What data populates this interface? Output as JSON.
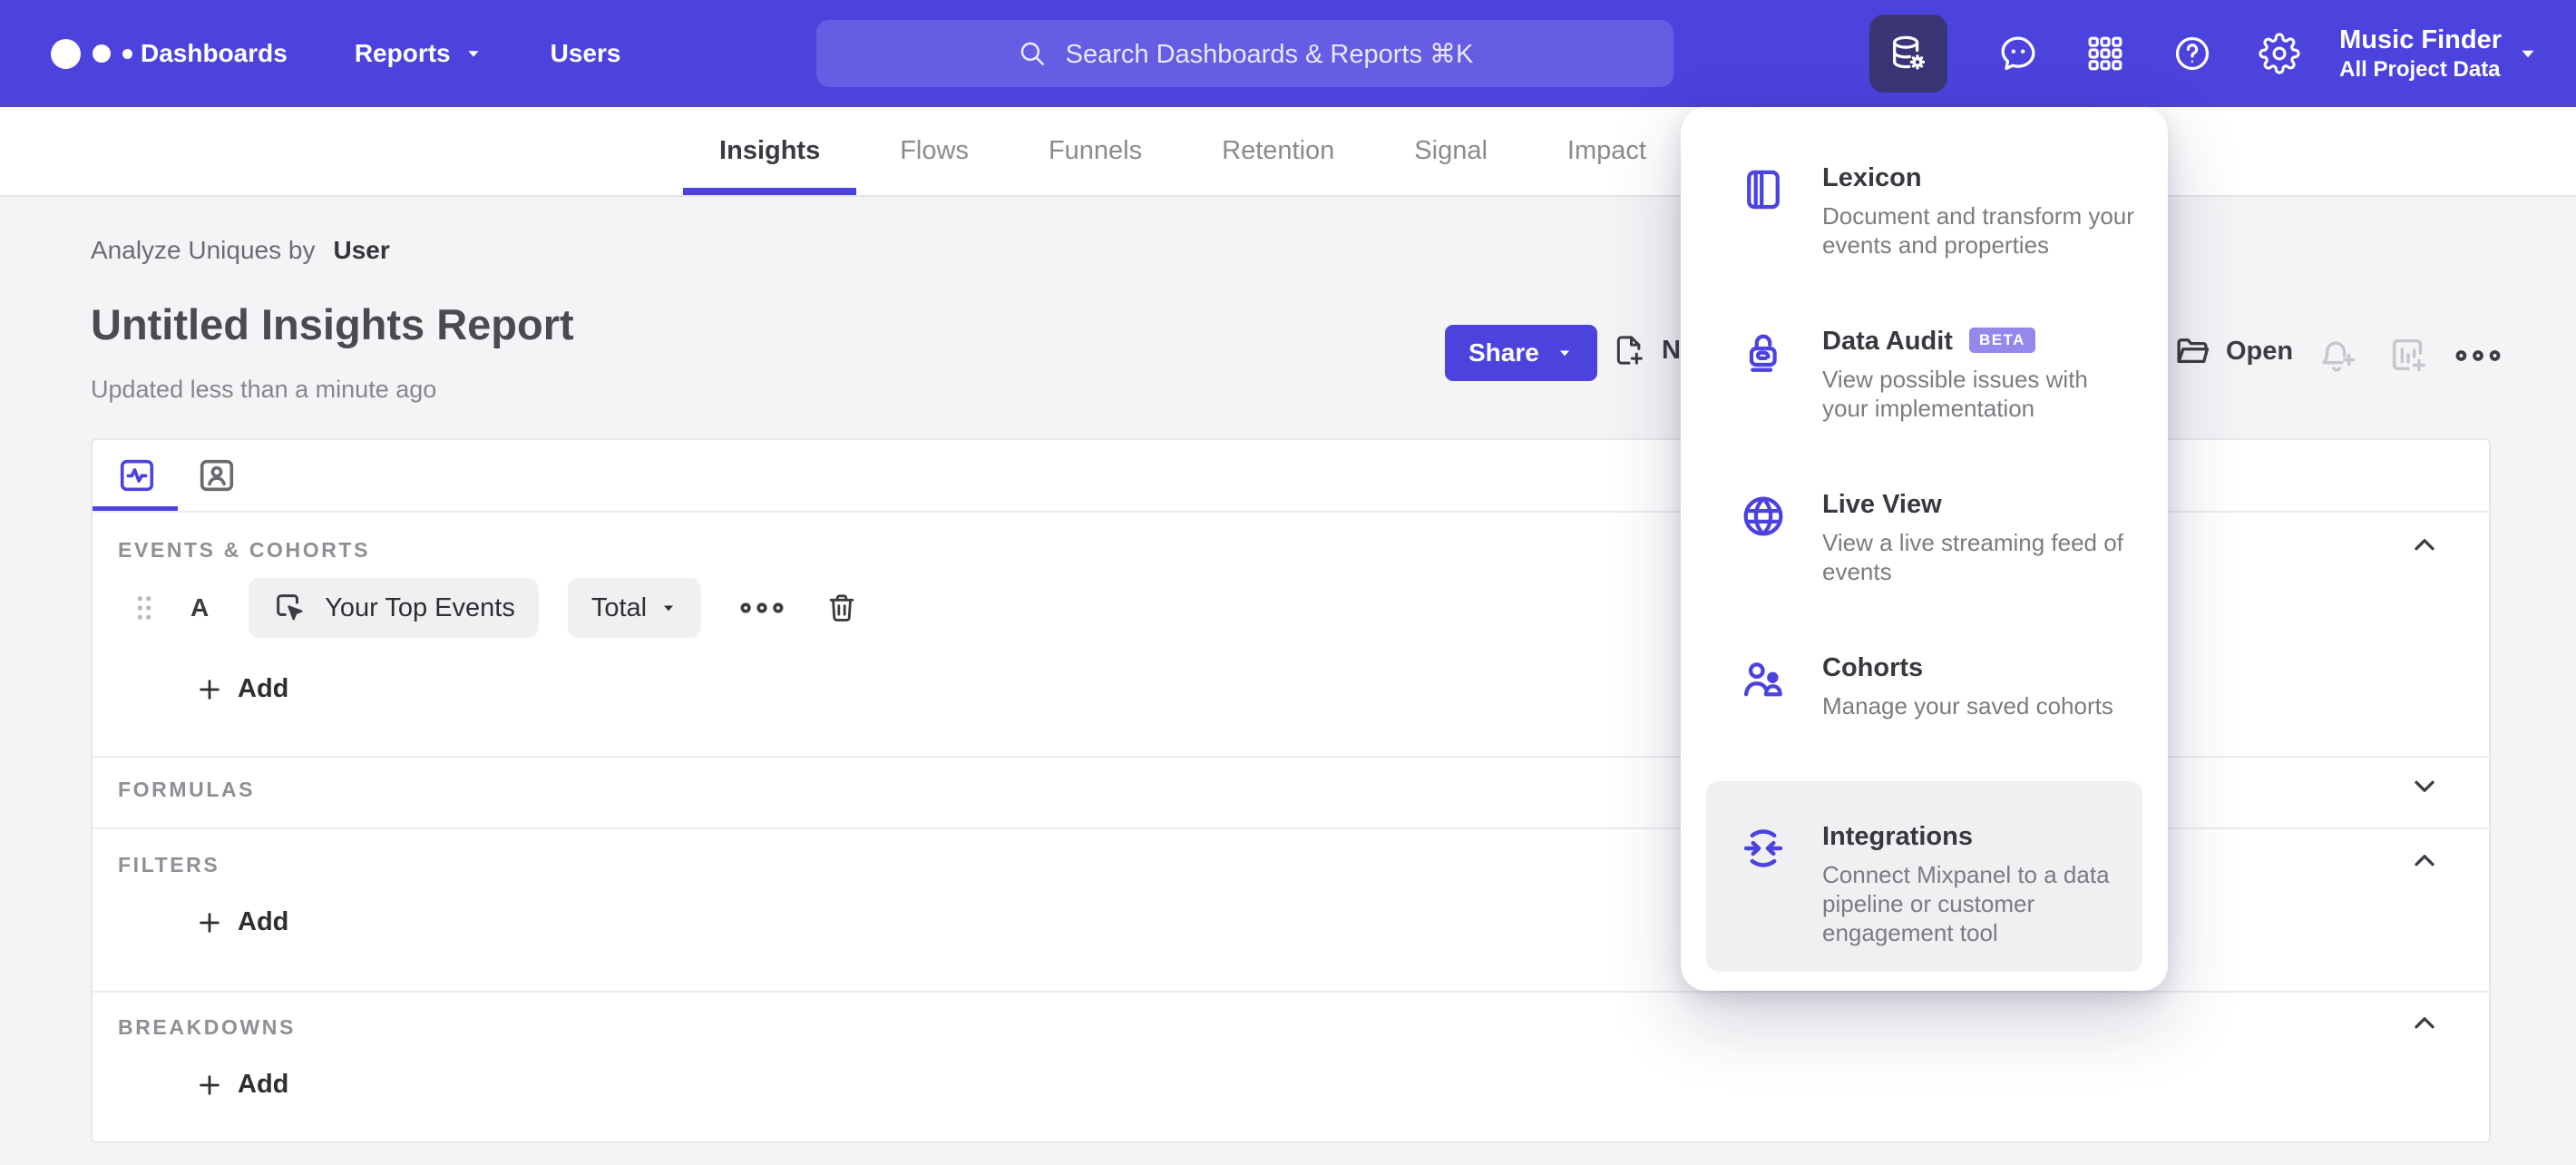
{
  "nav": {
    "menu": [
      {
        "label": "Dashboards"
      },
      {
        "label": "Reports"
      },
      {
        "label": "Users"
      }
    ],
    "search": {
      "placeholder": "Search Dashboards & Reports ⌘K"
    },
    "project": {
      "name": "Music Finder",
      "scope": "All Project Data"
    }
  },
  "report_tabs": [
    {
      "label": "Insights"
    },
    {
      "label": "Flows"
    },
    {
      "label": "Funnels"
    },
    {
      "label": "Retention"
    },
    {
      "label": "Signal"
    },
    {
      "label": "Impact"
    }
  ],
  "header": {
    "context_prefix": "Analyze Uniques by",
    "context_value": "User",
    "title": "Untitled Insights Report",
    "updated": "Updated less than a minute ago"
  },
  "toolbar": {
    "share_label": "Share",
    "new_label": "New",
    "open_label": "Open"
  },
  "data_menu": {
    "items": [
      {
        "title": "Lexicon",
        "description": "Document and transform your events and properties"
      },
      {
        "title": "Data Audit",
        "badge": "BETA",
        "description": "View possible issues with your implementation"
      },
      {
        "title": "Live View",
        "description": "View a live streaming feed of events"
      },
      {
        "title": "Cohorts",
        "description": "Manage your saved cohorts"
      },
      {
        "title": "Integrations",
        "description": "Connect Mixpanel to a data pipeline or customer engagement tool"
      }
    ]
  },
  "builder": {
    "events": {
      "label": "EVENTS & COHORTS",
      "row": {
        "series_letter": "A",
        "event_name": "Your Top Events",
        "metric": "Total"
      },
      "add_label": "Add"
    },
    "formulas": {
      "label": "FORMULAS"
    },
    "filters": {
      "label": "FILTERS",
      "add_label": "Add"
    },
    "breakdowns": {
      "label": "BREAKDOWNS",
      "add_label": "Add"
    }
  },
  "colors": {
    "nav_purple": "#4c43df",
    "accent": "#4c43df",
    "active_tile_bg": "#3b3575",
    "badge_bg": "#9289ea",
    "content_bg": "#f4f4f6"
  }
}
